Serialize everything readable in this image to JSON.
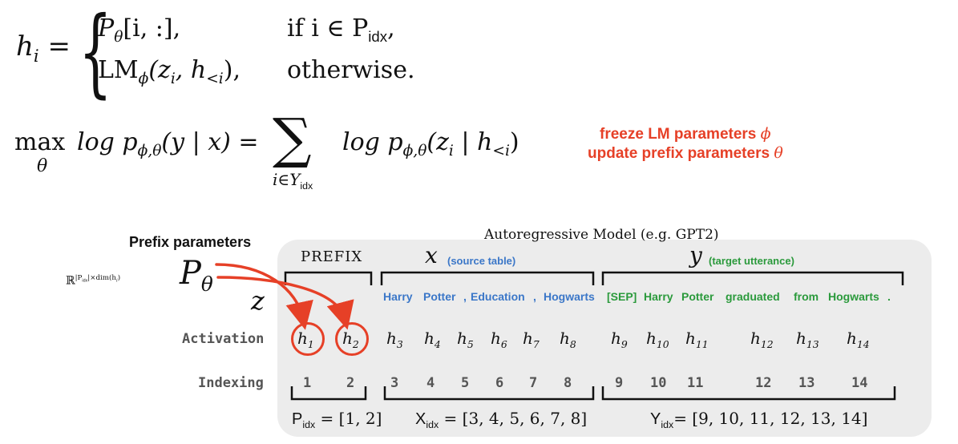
{
  "equations": {
    "eq1": {
      "lhs": "h",
      "lhs_sub": "i",
      "case1_expr_a": "P",
      "case1_expr_b": "θ",
      "case1_expr_c": "[i, :],",
      "case1_cond_a": "if i ∈ P",
      "case1_cond_b": "idx",
      "case1_cond_c": ",",
      "case2_expr_a": "LM",
      "case2_expr_b": "ϕ",
      "case2_expr_c": "(z",
      "case2_expr_d": "i",
      "case2_expr_e": ", h",
      "case2_expr_f": "<i",
      "case2_expr_g": "),",
      "case2_cond": "otherwise."
    },
    "eq2": {
      "max": "max",
      "max_sub": "θ",
      "lhs_a": "log p",
      "lhs_b": "ϕ,θ",
      "lhs_c": "(y | x) =",
      "sum": "∑",
      "sum_sub_a": "i∈Y",
      "sum_sub_b": "idx",
      "rhs_a": "log p",
      "rhs_b": "ϕ,θ",
      "rhs_c": "(z",
      "rhs_d": "i",
      "rhs_e": " | h",
      "rhs_f": "<i",
      "rhs_g": ")"
    }
  },
  "notes": {
    "freeze_a": "freeze LM parameters ",
    "freeze_b": "ϕ",
    "update_a": "update prefix parameters ",
    "update_b": "θ"
  },
  "model": {
    "title": "Autoregressive Model (e.g. GPT2)",
    "prefix_label": "PREFIX",
    "x_label": "x",
    "x_note": "(source table)",
    "y_label": "y",
    "y_note": "(target utterance)"
  },
  "prefix_params": {
    "label": "Prefix parameters",
    "dim_a": "ℝ",
    "dim_b": "|P",
    "dim_c": "idx",
    "dim_d": "|×dim(h",
    "dim_e": "i",
    "dim_f": ")",
    "p": "P",
    "theta": "θ",
    "z": "z"
  },
  "tokens": {
    "source": [
      "Harry",
      "Potter",
      ",",
      "Education",
      ",",
      "Hogwarts"
    ],
    "target": [
      "[SEP]",
      "Harry",
      "Potter",
      "graduated",
      "from",
      "Hogwarts",
      "."
    ]
  },
  "rows": {
    "activation_label": "Activation",
    "indexing_label": "Indexing"
  },
  "activations": [
    "1",
    "2",
    "3",
    "4",
    "5",
    "6",
    "7",
    "8",
    "9",
    "10",
    "11",
    "12",
    "13",
    "14"
  ],
  "indices": [
    "1",
    "2",
    "3",
    "4",
    "5",
    "6",
    "7",
    "8",
    "9",
    "10",
    "11",
    "12",
    "13",
    "14"
  ],
  "formulas": {
    "p_a": "P",
    "p_b": "idx",
    "p_c": " = [1, 2]",
    "x_a": "X",
    "x_b": "idx",
    "x_c": " = [3, 4, 5, 6, 7, 8]",
    "y_a": "Y",
    "y_b": "idx",
    "y_c": "= [9, 10, 11, 12, 13, 14]"
  },
  "colors": {
    "accent_red": "#e64027",
    "source_blue": "#3b77c8",
    "target_green": "#2b9a3c",
    "panel_gray": "#ececec"
  }
}
